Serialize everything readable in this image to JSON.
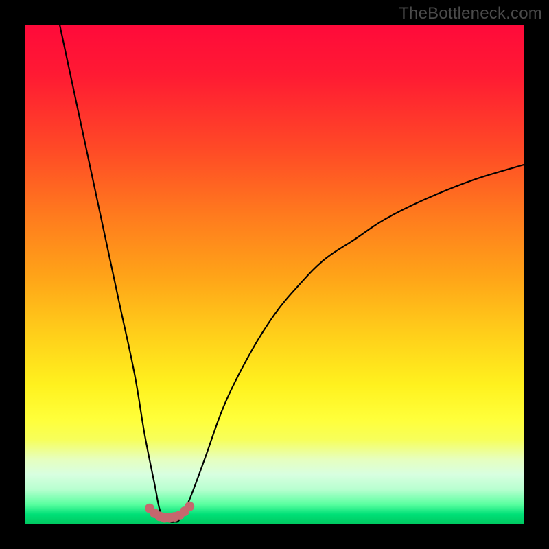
{
  "watermark": "TheBottleneck.com",
  "colors": {
    "frame": "#000000",
    "curve_stroke": "#000000",
    "dot_fill": "#c5676e",
    "gradient_top": "#ff0a3a",
    "gradient_mid": "#ffff3a",
    "gradient_bottom": "#00c860"
  },
  "chart_data": {
    "type": "line",
    "title": "",
    "xlabel": "",
    "ylabel": "",
    "xlim": [
      0,
      100
    ],
    "ylim": [
      0,
      100
    ],
    "grid": false,
    "legend": false,
    "annotations": [],
    "notes": "Axes carry no visible tick labels. The curve is a sharp V (bottleneck curve): y goes from ~100 at x~7 down to ~0 near x~27, stays near 0 from x~27 to x~31, then rises steeply and decelerates, ending near y~72 at x=100. A short band of ~9 rose-colored dots sits at the valley floor spanning roughly x=25–33.",
    "series": [
      {
        "name": "bottleneck-curve",
        "x": [
          7,
          10,
          13,
          16,
          19,
          22,
          24,
          26,
          27,
          28,
          29,
          30,
          31,
          33,
          36,
          40,
          45,
          50,
          55,
          60,
          66,
          72,
          80,
          90,
          100
        ],
        "y": [
          100,
          86,
          72,
          58,
          44,
          30,
          18,
          8,
          3,
          1,
          0.5,
          0.5,
          1,
          5,
          13,
          24,
          34,
          42,
          48,
          53,
          57,
          61,
          65,
          69,
          72
        ]
      }
    ],
    "dots": {
      "name": "valley-dots",
      "x": [
        25.0,
        26.0,
        27.0,
        28.0,
        29.0,
        30.0,
        31.0,
        32.0,
        33.0
      ],
      "y": [
        3.2,
        2.2,
        1.6,
        1.3,
        1.3,
        1.5,
        1.8,
        2.6,
        3.6
      ],
      "radius_px": 7
    }
  }
}
